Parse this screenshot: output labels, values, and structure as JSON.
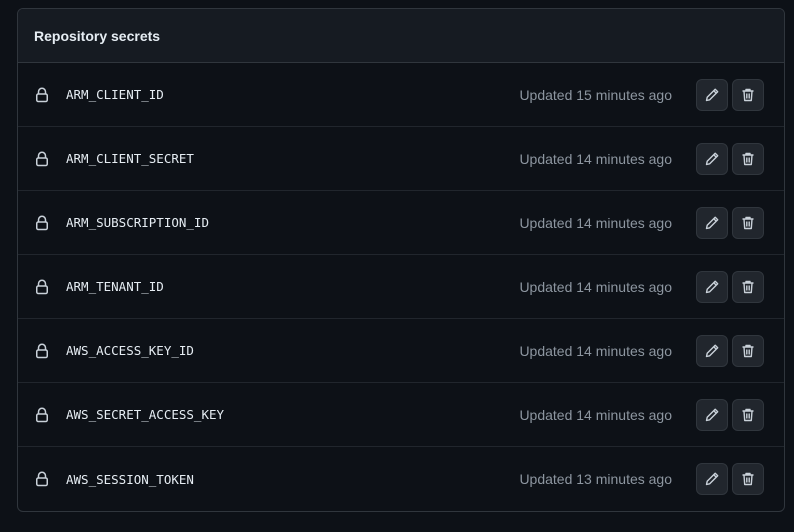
{
  "panel": {
    "title": "Repository secrets"
  },
  "secrets": [
    {
      "name": "ARM_CLIENT_ID",
      "updated": "Updated 15 minutes ago"
    },
    {
      "name": "ARM_CLIENT_SECRET",
      "updated": "Updated 14 minutes ago"
    },
    {
      "name": "ARM_SUBSCRIPTION_ID",
      "updated": "Updated 14 minutes ago"
    },
    {
      "name": "ARM_TENANT_ID",
      "updated": "Updated 14 minutes ago"
    },
    {
      "name": "AWS_ACCESS_KEY_ID",
      "updated": "Updated 14 minutes ago"
    },
    {
      "name": "AWS_SECRET_ACCESS_KEY",
      "updated": "Updated 14 minutes ago"
    },
    {
      "name": "AWS_SESSION_TOKEN",
      "updated": "Updated 13 minutes ago"
    }
  ],
  "icons": {
    "row": "lock-icon",
    "edit": "pencil-icon",
    "delete": "trash-icon"
  },
  "colors": {
    "background": "#0d1117",
    "header": "#161b22",
    "border": "#30363d",
    "muted_text": "#8d96a0"
  }
}
